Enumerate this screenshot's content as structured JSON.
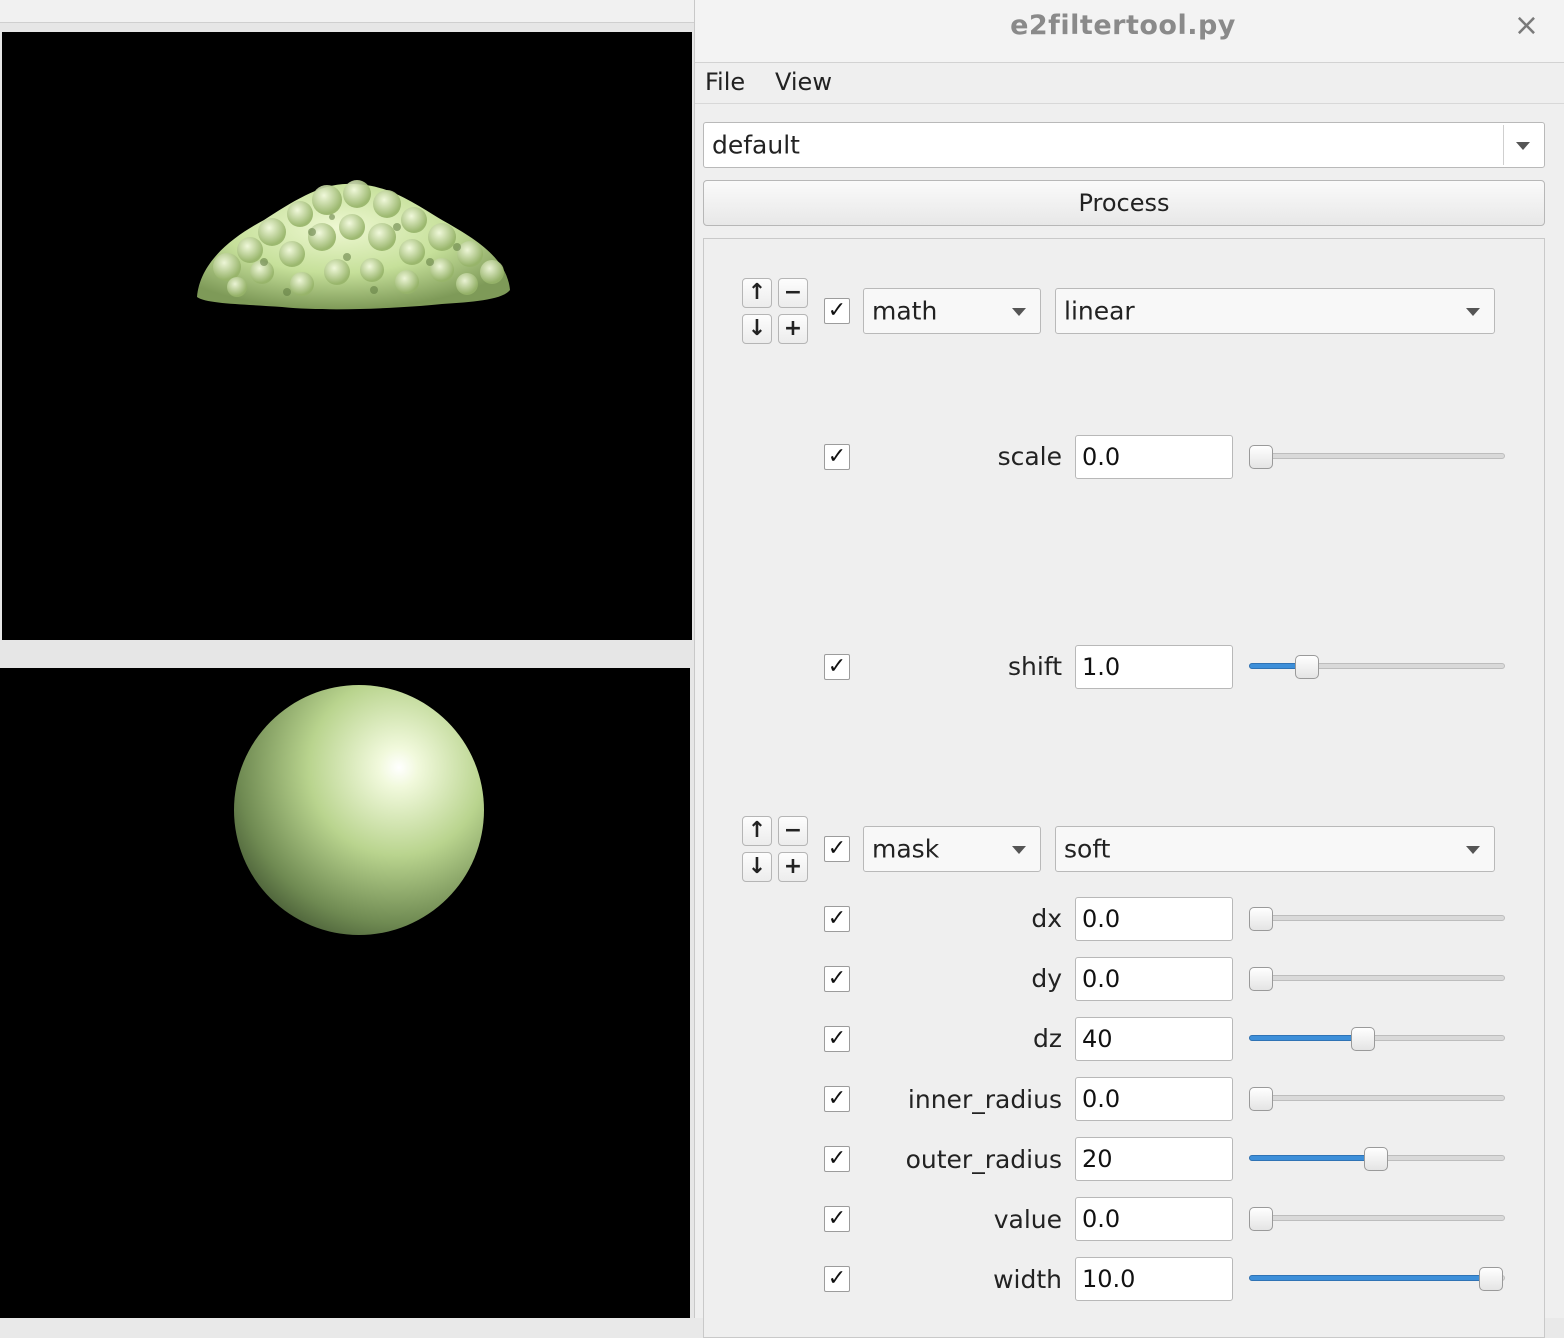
{
  "window": {
    "title": "e2filtertool.py"
  },
  "menu": {
    "file": "File",
    "view": "View"
  },
  "preset": {
    "value": "default"
  },
  "process_label": "Process",
  "filters": [
    {
      "category": "math",
      "name": "linear",
      "enabled": true,
      "params": [
        {
          "label": "scale",
          "value": "0.0",
          "enabled": true,
          "slider": 0.0
        },
        {
          "label": "shift",
          "value": "1.0",
          "enabled": true,
          "slider": 0.22
        }
      ]
    },
    {
      "category": "mask",
      "name": "soft",
      "enabled": true,
      "params": [
        {
          "label": "dx",
          "value": "0.0",
          "enabled": true,
          "slider": 0.0
        },
        {
          "label": "dy",
          "value": "0.0",
          "enabled": true,
          "slider": 0.0
        },
        {
          "label": "dz",
          "value": "40",
          "enabled": true,
          "slider": 0.45
        },
        {
          "label": "inner_radius",
          "value": "0.0",
          "enabled": true,
          "slider": 0.0
        },
        {
          "label": "outer_radius",
          "value": "20",
          "enabled": true,
          "slider": 0.5
        },
        {
          "label": "value",
          "value": "0.0",
          "enabled": true,
          "slider": 0.0
        },
        {
          "label": "width",
          "value": "10.0",
          "enabled": true,
          "slider": 1.0
        }
      ]
    }
  ],
  "icons": {
    "check": "✓",
    "up": "↑",
    "down": "↓",
    "minus": "−",
    "plus": "+",
    "close": "×"
  },
  "colors": {
    "accent": "#3d8fd9",
    "surface_color": "#c9e6a0",
    "viewport_bg": "#000000"
  }
}
